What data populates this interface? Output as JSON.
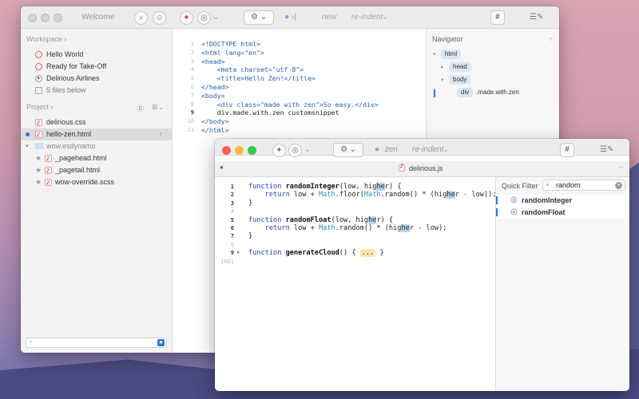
{
  "colors": {
    "accent": "#2f74d0",
    "mark": "#2f74d0"
  },
  "window1": {
    "title": "Welcome",
    "new_label": "new",
    "reindent_label": "re-indent",
    "workspace": {
      "header": "Workspace",
      "items": [
        {
          "label": "Hello World",
          "icon": "compass-icon"
        },
        {
          "label": "Ready for Take-Off",
          "icon": "compass-icon"
        },
        {
          "label": "Delirious Airlines",
          "icon": "play-icon"
        },
        {
          "label": "5 files below",
          "icon": "file-icon"
        }
      ]
    },
    "project": {
      "header": "Project",
      "files": [
        {
          "label": "delirious.css"
        },
        {
          "label": "hello-zen.html"
        },
        {
          "label": "wow.esdynamo"
        },
        {
          "label": "_pagehead.html"
        },
        {
          "label": "_pagetail.html"
        },
        {
          "label": "wow-override.scss"
        }
      ]
    },
    "editor": {
      "line_numbers": [
        "1",
        "2",
        "3",
        "4",
        "5",
        "6",
        "7",
        "8",
        "9",
        "10",
        "11"
      ],
      "lines": [
        "<!DOCTYPE html>",
        "<html lang=\"en\">",
        "<head>",
        "    <meta charset=\"utf-8\">",
        "    <title>Hello Zen!</title>",
        "</head>",
        "<body>",
        "    <div class=\"made with zen\">So easy.</div>",
        "    div.made.with.zen customsnippet",
        "</body>",
        "</html>"
      ]
    },
    "navigator": {
      "header": "Navigator",
      "nodes": [
        "html",
        "head",
        "body",
        "div",
        ".made.with.zen"
      ]
    }
  },
  "window2": {
    "title": "delirious.js",
    "mode_label": "zen",
    "reindent_label": "re-indent",
    "code": {
      "line_numbers": [
        "1",
        "2",
        "3",
        "4",
        "5",
        "6",
        "7",
        "8",
        "9",
        "1001"
      ],
      "fold_label": "..."
    },
    "quick_filter": {
      "label": "Quick Filter",
      "value": "random",
      "results": [
        "randomInteger",
        "randomFloat"
      ]
    }
  }
}
